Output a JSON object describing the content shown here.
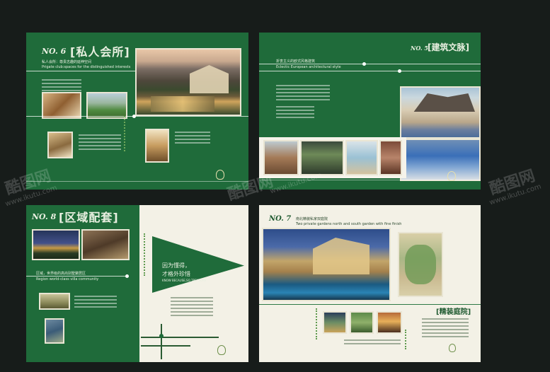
{
  "page1": {
    "no_label": "NO. 6",
    "title": "[私人会所]",
    "subtitle_cn": "私人会所：尊贵志趣的延伸空间",
    "subtitle_en": "Prigate club:spaces for the distinguished interests"
  },
  "page2": {
    "no_label": "NO. 5",
    "title": "[建筑文脉]",
    "subtitle_cn": "折衷主义的欧式风格建筑",
    "subtitle_en": "Eclectic European architectural style"
  },
  "page3": {
    "no_label": "NO. 8",
    "title": "[区域配套]",
    "subtitle_cn": "区域，世界级的高尚别墅聚居区",
    "subtitle_en": "Region world-class villa community",
    "triangle_line1": "因为懂得，",
    "triangle_line2": "才格外珍惜",
    "triangle_en": "KNOW BECAUSE,SO TREASURE"
  },
  "page4": {
    "no_label": "NO. 7",
    "subtitle_cn": "南北精装私家双庭院",
    "subtitle_en": "Two private gardens north and south garden with fine finish",
    "garden_title": "[精装庭院]"
  },
  "watermark": {
    "brand": "酷图网",
    "url": "www.ikutu.com"
  },
  "colors": {
    "page_green": "#1f6b3a",
    "page_cream": "#f3f1e6",
    "background": "#171c1a"
  }
}
